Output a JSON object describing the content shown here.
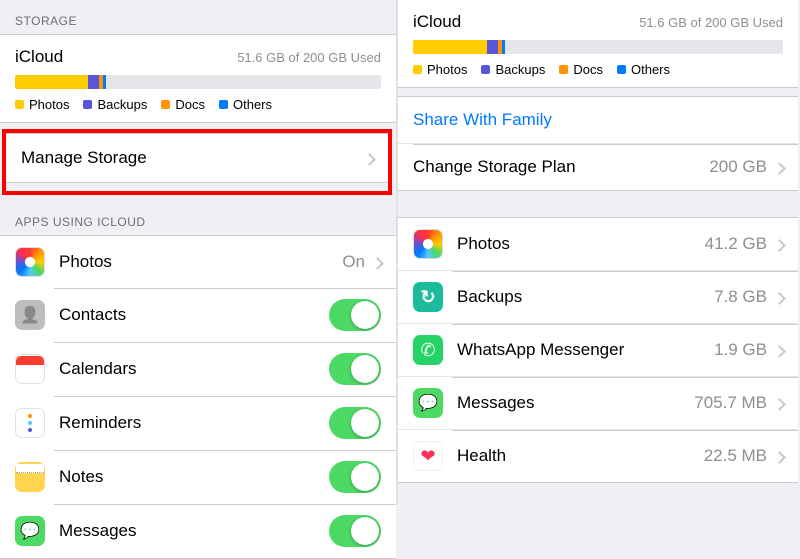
{
  "colors": {
    "photos": "#ffcc00",
    "backups": "#5856d6",
    "docs": "#ff9500",
    "others": "#007aff"
  },
  "left": {
    "section_storage": "STORAGE",
    "icloud": {
      "title": "iCloud",
      "usage": "51.6 GB of 200 GB Used",
      "segments": [
        {
          "key": "photos",
          "pct": 20
        },
        {
          "key": "backups",
          "pct": 3
        },
        {
          "key": "docs",
          "pct": 1
        },
        {
          "key": "others",
          "pct": 1
        }
      ],
      "legend": [
        {
          "key": "photos",
          "label": "Photos"
        },
        {
          "key": "backups",
          "label": "Backups"
        },
        {
          "key": "docs",
          "label": "Docs"
        },
        {
          "key": "others",
          "label": "Others"
        }
      ]
    },
    "manage": "Manage Storage",
    "section_apps": "APPS USING ICLOUD",
    "apps": [
      {
        "key": "photos",
        "label": "Photos",
        "control": "detail",
        "detail": "On"
      },
      {
        "key": "contacts",
        "label": "Contacts",
        "control": "toggle",
        "on": true
      },
      {
        "key": "calendars",
        "label": "Calendars",
        "control": "toggle",
        "on": true
      },
      {
        "key": "reminders",
        "label": "Reminders",
        "control": "toggle",
        "on": true
      },
      {
        "key": "notes",
        "label": "Notes",
        "control": "toggle",
        "on": true
      },
      {
        "key": "messages",
        "label": "Messages",
        "control": "toggle",
        "on": true
      }
    ]
  },
  "right": {
    "icloud": {
      "title": "iCloud",
      "usage": "51.6 GB of 200 GB Used",
      "segments": [
        {
          "key": "photos",
          "pct": 20
        },
        {
          "key": "backups",
          "pct": 3
        },
        {
          "key": "docs",
          "pct": 1
        },
        {
          "key": "others",
          "pct": 1
        }
      ],
      "legend": [
        {
          "key": "photos",
          "label": "Photos"
        },
        {
          "key": "backups",
          "label": "Backups"
        },
        {
          "key": "docs",
          "label": "Docs"
        },
        {
          "key": "others",
          "label": "Others"
        }
      ]
    },
    "share": "Share With Family",
    "plan": {
      "label": "Change Storage Plan",
      "value": "200 GB"
    },
    "usage_items": [
      {
        "key": "photos",
        "label": "Photos",
        "size": "41.2 GB"
      },
      {
        "key": "backups",
        "label": "Backups",
        "size": "7.8 GB"
      },
      {
        "key": "whatsapp",
        "label": "WhatsApp Messenger",
        "size": "1.9 GB"
      },
      {
        "key": "messages",
        "label": "Messages",
        "size": "705.7 MB"
      },
      {
        "key": "health",
        "label": "Health",
        "size": "22.5 MB"
      }
    ]
  }
}
